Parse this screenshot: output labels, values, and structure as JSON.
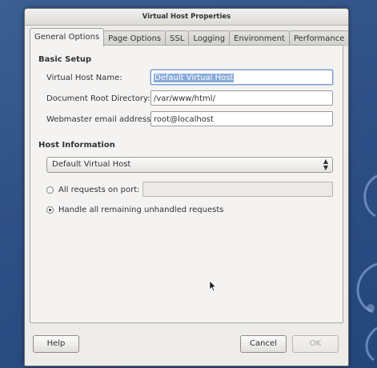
{
  "window": {
    "title": "Virtual Host Properties"
  },
  "tabs": [
    {
      "label": "General Options",
      "active": true
    },
    {
      "label": "Page Options",
      "active": false
    },
    {
      "label": "SSL",
      "active": false
    },
    {
      "label": "Logging",
      "active": false
    },
    {
      "label": "Environment",
      "active": false
    },
    {
      "label": "Performance",
      "active": false
    }
  ],
  "basic_setup": {
    "heading": "Basic Setup",
    "vhost_name_label": "Virtual Host Name:",
    "vhost_name_value": "Default Virtual Host",
    "doc_root_label": "Document Root Directory:",
    "doc_root_value": "/var/www/html/",
    "webmaster_label": "Webmaster email address:",
    "webmaster_value": "root@localhost"
  },
  "host_info": {
    "heading": "Host Information",
    "selected": "Default Virtual Host",
    "option_all_requests": "All requests on port:",
    "all_requests_port_value": "",
    "option_unhandled": "Handle all remaining unhandled requests",
    "selected_option": "unhandled"
  },
  "buttons": {
    "help": "Help",
    "cancel": "Cancel",
    "ok": "OK"
  }
}
